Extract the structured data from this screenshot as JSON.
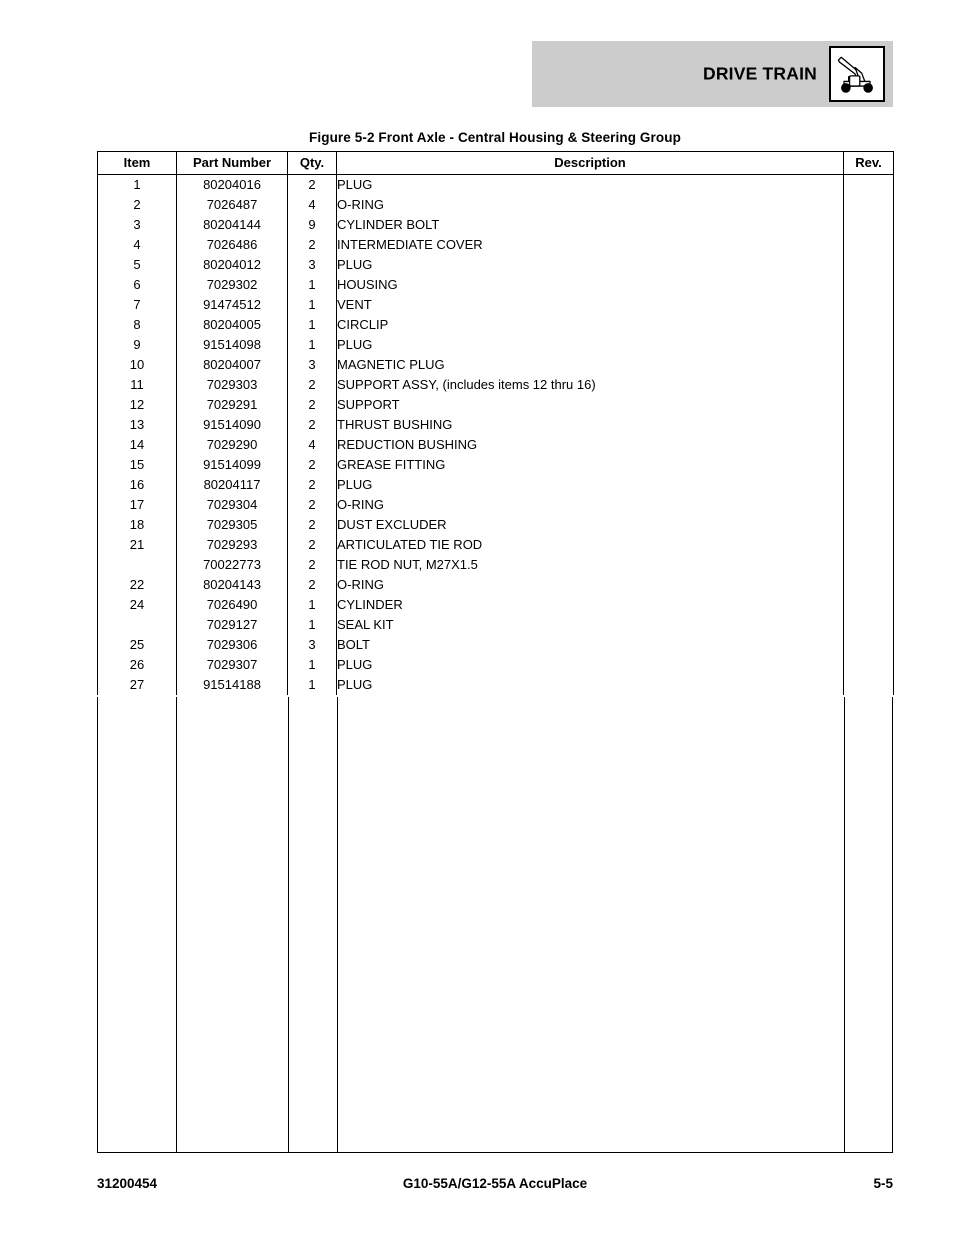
{
  "header": {
    "section_title": "DRIVE TRAIN",
    "icon": "telehandler-icon",
    "banner_color": "#cccccc"
  },
  "figure": {
    "title": "Figure 5-2 Front Axle - Central Housing & Steering Group"
  },
  "table": {
    "columns": [
      "Item",
      "Part Number",
      "Qty.",
      "Description",
      "Rev."
    ],
    "rows": [
      {
        "item": "1",
        "part": "80204016",
        "qty": "2",
        "desc": "PLUG",
        "indent": false,
        "rev": ""
      },
      {
        "item": "2",
        "part": "7026487",
        "qty": "4",
        "desc": "O-RING",
        "indent": false,
        "rev": ""
      },
      {
        "item": "3",
        "part": "80204144",
        "qty": "9",
        "desc": "CYLINDER BOLT",
        "indent": false,
        "rev": ""
      },
      {
        "item": "4",
        "part": "7026486",
        "qty": "2",
        "desc": "INTERMEDIATE COVER",
        "indent": false,
        "rev": ""
      },
      {
        "item": "5",
        "part": "80204012",
        "qty": "3",
        "desc": "PLUG",
        "indent": false,
        "rev": ""
      },
      {
        "item": "6",
        "part": "7029302",
        "qty": "1",
        "desc": "HOUSING",
        "indent": false,
        "rev": ""
      },
      {
        "item": "7",
        "part": "91474512",
        "qty": "1",
        "desc": "VENT",
        "indent": false,
        "rev": ""
      },
      {
        "item": "8",
        "part": "80204005",
        "qty": "1",
        "desc": "CIRCLIP",
        "indent": false,
        "rev": ""
      },
      {
        "item": "9",
        "part": "91514098",
        "qty": "1",
        "desc": "PLUG",
        "indent": false,
        "rev": ""
      },
      {
        "item": "10",
        "part": "80204007",
        "qty": "3",
        "desc": "MAGNETIC PLUG",
        "indent": false,
        "rev": ""
      },
      {
        "item": "11",
        "part": "7029303",
        "qty": "2",
        "desc": "SUPPORT ASSY, (includes items 12 thru 16)",
        "indent": false,
        "rev": ""
      },
      {
        "item": "12",
        "part": "7029291",
        "qty": "2",
        "desc": "SUPPORT",
        "indent": true,
        "rev": ""
      },
      {
        "item": "13",
        "part": "91514090",
        "qty": "2",
        "desc": "THRUST BUSHING",
        "indent": true,
        "rev": ""
      },
      {
        "item": "14",
        "part": "7029290",
        "qty": "4",
        "desc": "REDUCTION BUSHING",
        "indent": true,
        "rev": ""
      },
      {
        "item": "15",
        "part": "91514099",
        "qty": "2",
        "desc": "GREASE FITTING",
        "indent": true,
        "rev": ""
      },
      {
        "item": "16",
        "part": "80204117",
        "qty": "2",
        "desc": "PLUG",
        "indent": true,
        "rev": ""
      },
      {
        "item": "17",
        "part": "7029304",
        "qty": "2",
        "desc": "O-RING",
        "indent": false,
        "rev": ""
      },
      {
        "item": "18",
        "part": "7029305",
        "qty": "2",
        "desc": "DUST EXCLUDER",
        "indent": false,
        "rev": ""
      },
      {
        "item": "21",
        "part": "7029293",
        "qty": "2",
        "desc": "ARTICULATED TIE ROD",
        "indent": false,
        "rev": ""
      },
      {
        "item": "",
        "part": "70022773",
        "qty": "2",
        "desc": "TIE ROD NUT, M27X1.5",
        "indent": true,
        "rev": ""
      },
      {
        "item": "22",
        "part": "80204143",
        "qty": "2",
        "desc": "O-RING",
        "indent": false,
        "rev": ""
      },
      {
        "item": "24",
        "part": "7026490",
        "qty": "1",
        "desc": "CYLINDER",
        "indent": false,
        "rev": ""
      },
      {
        "item": "",
        "part": "7029127",
        "qty": "1",
        "desc": "SEAL KIT",
        "indent": true,
        "rev": ""
      },
      {
        "item": "25",
        "part": "7029306",
        "qty": "3",
        "desc": "BOLT",
        "indent": false,
        "rev": ""
      },
      {
        "item": "26",
        "part": "7029307",
        "qty": "1",
        "desc": "PLUG",
        "indent": false,
        "rev": ""
      },
      {
        "item": "27",
        "part": "91514188",
        "qty": "1",
        "desc": "PLUG",
        "indent": false,
        "rev": ""
      }
    ]
  },
  "footer": {
    "document_number": "31200454",
    "model": "G10-55A/G12-55A AccuPlace",
    "page": "5-5"
  }
}
